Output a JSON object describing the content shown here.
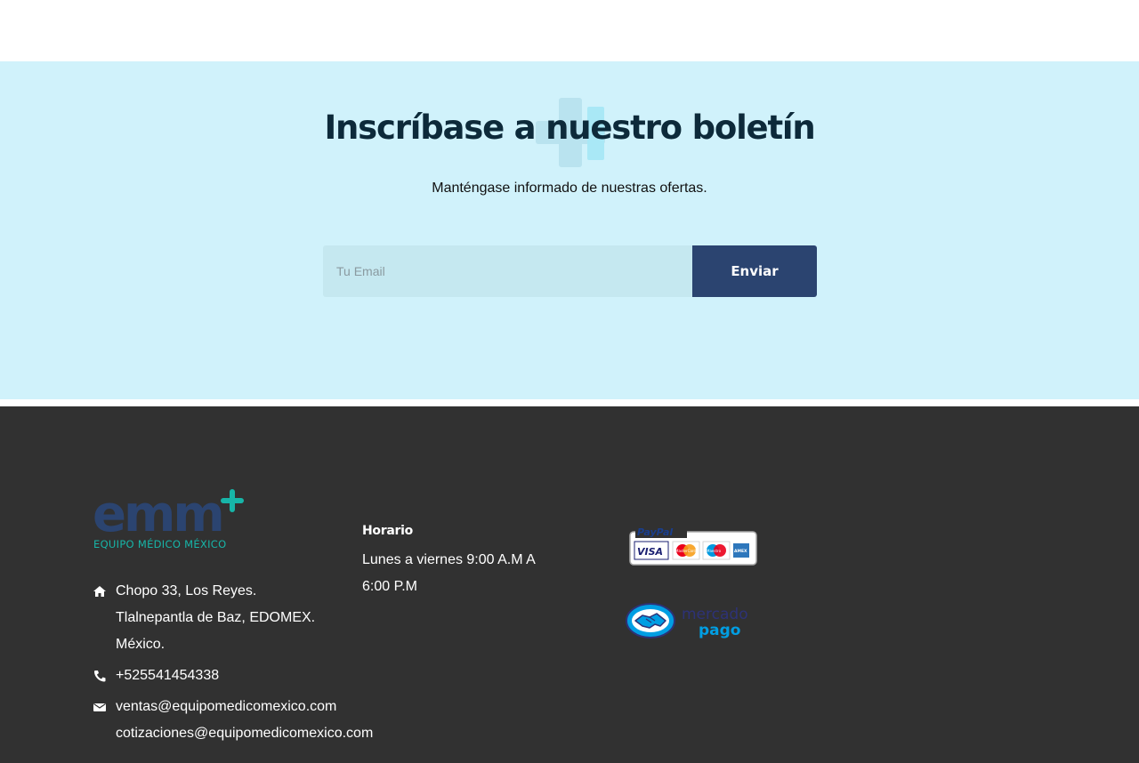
{
  "newsletter": {
    "title": "Inscríbase a nuestro boletín",
    "subtitle": "Manténgase informado de nuestras ofertas.",
    "email_placeholder": "Tu Email",
    "submit_label": "Enviar",
    "background_color": "#d0f2fb",
    "button_color": "#2b4470"
  },
  "footer": {
    "background_color": "#313131",
    "logo": {
      "wordmark": "emm",
      "tagline": "EQUIPO MÉDICO MÉXICO",
      "primary_color": "#2b4470",
      "accent_color": "#17b5a8"
    },
    "contact": {
      "address_lines": [
        "Chopo 33, Los Reyes.",
        "Tlalnepantla de Baz, EDOMEX.",
        "México."
      ],
      "address_icon": "home-icon",
      "phone": "+525541454338",
      "phone_icon": "phone-icon",
      "emails": [
        "ventas@equipomedicomexico.com",
        "cotizaciones@equipomedicomexico.com"
      ],
      "email_icon": "envelope-icon"
    },
    "hours": {
      "title": "Horario",
      "lines": [
        "Lunes a viernes 9:00 A.M A",
        "6:00 P.M"
      ]
    },
    "payments": {
      "paypal": {
        "brand": "PayPal",
        "cards": [
          "VISA",
          "MasterCard",
          "Maestro",
          "AMEX"
        ]
      },
      "mercadopago": {
        "brand_line1": "mercado",
        "brand_line2": "pago",
        "color": "#009ee3"
      }
    }
  }
}
